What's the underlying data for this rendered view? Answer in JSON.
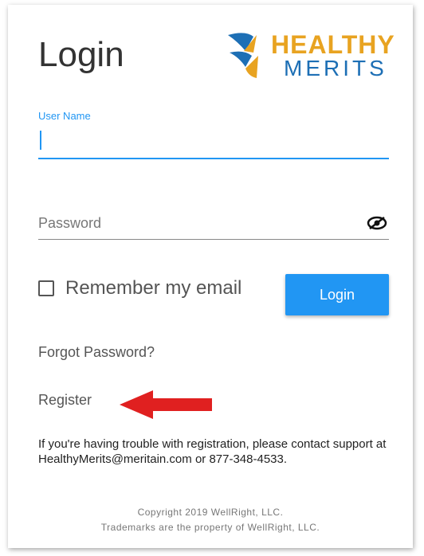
{
  "login": {
    "title": "Login",
    "logo": {
      "line1": "HEALTHY",
      "line2": "MERITS"
    },
    "username": {
      "label": "User Name",
      "value": ""
    },
    "password": {
      "placeholder": "Password",
      "value": ""
    },
    "remember": {
      "label": "Remember my email",
      "checked": false
    },
    "login_button": "Login",
    "forgot_link": "Forgot Password?",
    "register_link": "Register",
    "trouble_text": "If you're having trouble with registration, please contact support at HealthyMerits@meritain.com or 877-348-4533.",
    "copyright_line1": "Copyright 2019 WellRight, LLC.",
    "copyright_line2": "Trademarks are the property of WellRight, LLC."
  },
  "icons": {
    "eye": "eye-slash-icon",
    "arrow": "red-arrow-left-icon"
  },
  "colors": {
    "accent": "#2196f3",
    "logo_gold": "#e8a321",
    "logo_blue": "#1d6fb5",
    "arrow": "#e02020"
  }
}
